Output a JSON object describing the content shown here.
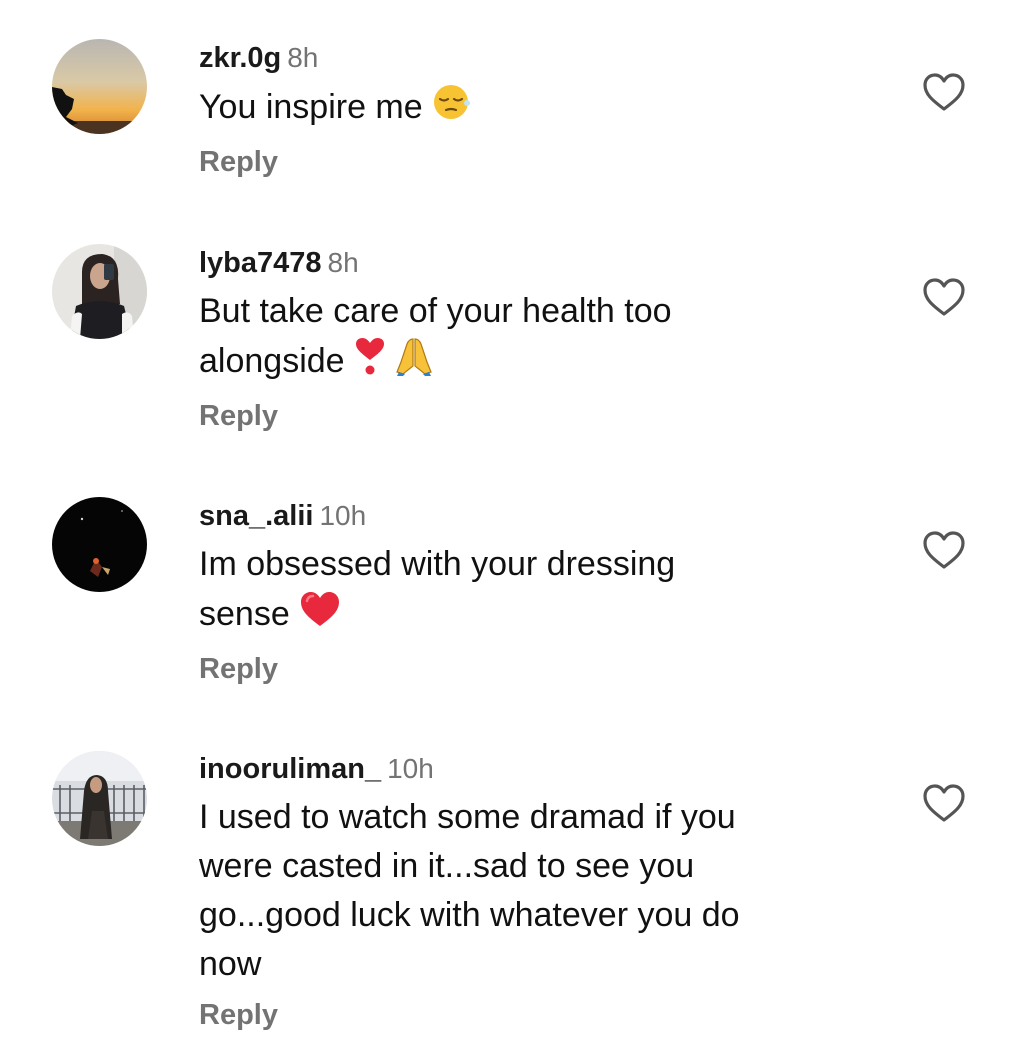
{
  "comments": [
    {
      "username": "zkr.0g",
      "time": "8h",
      "text": "You inspire me",
      "emoji": "relieved-face-emoji",
      "reply_label": "Reply",
      "avatar": "sunset-avatar"
    },
    {
      "username": "lyba7478",
      "time": "8h",
      "text_line1": "But take care of your health too",
      "text_line2": "alongside",
      "emoji": [
        "heavy-exclamation-heart-emoji",
        "folded-hands-emoji"
      ],
      "reply_label": "Reply",
      "avatar": "mirror-selfie-avatar"
    },
    {
      "username": "sna_.alii",
      "time": "10h",
      "text_line1": "Im obsessed with your dressing",
      "text_line2": "sense",
      "emoji": "red-heart-emoji",
      "reply_label": "Reply",
      "avatar": "night-sky-avatar"
    },
    {
      "username": "inooruliman_",
      "time": "10h",
      "text_line1": "I used to watch some dramad if you",
      "text_line2": "were casted in it...sad to see you",
      "text_line3": "go...good luck with whatever you do",
      "text_line4": "now",
      "reply_label": "Reply",
      "avatar": "outdoor-portrait-avatar"
    }
  ],
  "icons": {
    "like": "heart-outline-icon"
  },
  "colors": {
    "text": "#111111",
    "muted": "#737373",
    "heart_red": "#e8283c"
  }
}
